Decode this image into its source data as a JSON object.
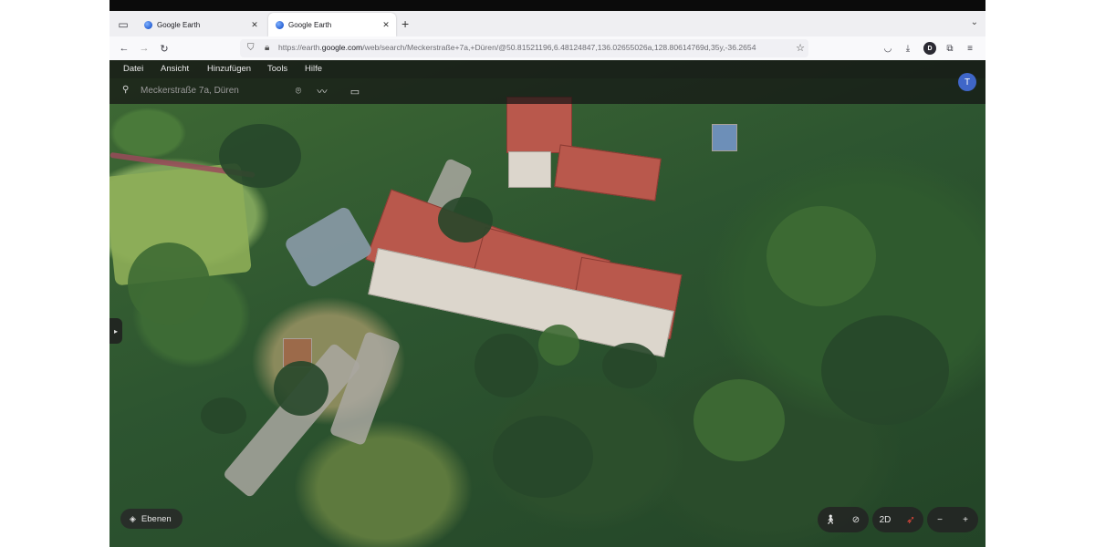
{
  "browser": {
    "tabs": [
      {
        "title": "Google Earth",
        "close": "✕"
      },
      {
        "title": "Google Earth",
        "close": "✕"
      }
    ],
    "new_tab": "+",
    "url_prefix": "https://earth.",
    "url_host": "google.com",
    "url_rest": "/web/search/Meckerstraße+7a,+Düren/@50.81521196,6.48124847,136.02655026a,128.80614769d,35y,-36.2654",
    "profile_initial": "D"
  },
  "earth": {
    "menu": [
      "Datei",
      "Ansicht",
      "Hinzufügen",
      "Tools",
      "Hilfe"
    ],
    "search_placeholder": "Meckerstraße 7a, Düren",
    "avatar_initial": "T",
    "layers_label": "Ebenen",
    "view_2d_label": "2D",
    "zoom_out": "−",
    "zoom_in": "+"
  },
  "icons": {
    "tab_list": "tab-list-icon",
    "back": "back-arrow-icon",
    "forward": "forward-arrow-icon",
    "reload": "reload-icon",
    "search": "search-icon",
    "place": "location-pin-icon",
    "path": "path-icon",
    "ruler": "ruler-icon",
    "pegman": "pegman-icon",
    "tilt": "tilt-icon",
    "compass": "compass-icon"
  }
}
